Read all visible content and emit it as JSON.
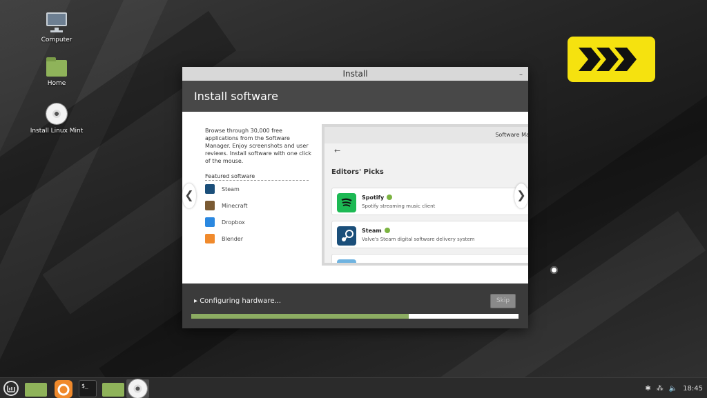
{
  "desktop": {
    "icons": [
      {
        "label": "Computer",
        "icon": "computer-icon"
      },
      {
        "label": "Home",
        "icon": "home-folder-icon"
      },
      {
        "label": "Install Linux Mint",
        "icon": "disc-icon"
      }
    ]
  },
  "window": {
    "title": "Install",
    "minimize_symbol": "–",
    "header": "Install software",
    "slide": {
      "description": "Browse through 30,000 free applications from the Software Manager. Enjoy screenshots and user reviews. Install software with one click of the mouse.",
      "featured_title": "Featured software",
      "featured": [
        {
          "name": "Steam",
          "icon": "steam-icon",
          "color": "#1b4f7a"
        },
        {
          "name": "Minecraft",
          "icon": "minecraft-icon",
          "color": "#7a5a33"
        },
        {
          "name": "Dropbox",
          "icon": "dropbox-icon",
          "color": "#2b88e0"
        },
        {
          "name": "Blender",
          "icon": "blender-icon",
          "color": "#f08a2c"
        }
      ],
      "prev_arrow": "❮",
      "next_arrow": "❯",
      "software_manager": {
        "title": "Software Man",
        "back": "←",
        "heading": "Editors' Picks",
        "cards": [
          {
            "name": "Spotify",
            "desc": "Spotify streaming music client",
            "icon": "spotify-icon",
            "color": "#1db954"
          },
          {
            "name": "Steam",
            "desc": "Valve's Steam digital software delivery system",
            "icon": "steam-icon",
            "color": "#1b4f7a"
          }
        ]
      }
    },
    "status": "▸ Configuring hardware...",
    "skip_label": "Skip",
    "progress_fraction": 0.665
  },
  "taskbar": {
    "items": [
      "mint-menu-icon",
      "files-folder-icon",
      "firefox-icon",
      "terminal-icon",
      "files-folder-icon",
      "disc-icon"
    ],
    "terminal_glyph": "$_",
    "tray": {
      "bluetooth": "✱",
      "network": "⁂",
      "volume": "🔈",
      "clock": "18:45"
    }
  },
  "colors": {
    "accent_green": "#8cac62",
    "logo_yellow": "#f5e20f"
  }
}
